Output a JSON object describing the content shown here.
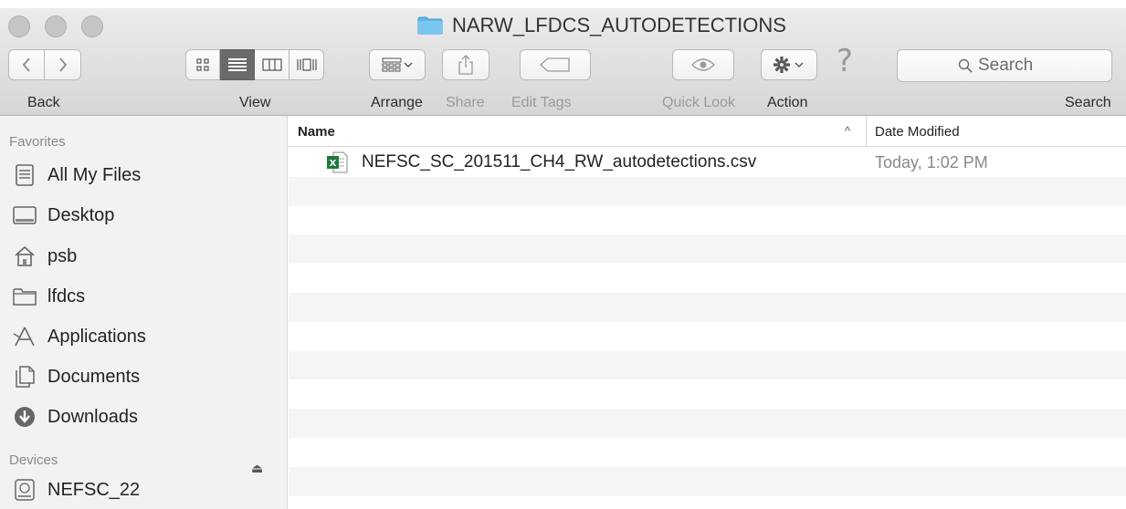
{
  "window": {
    "title": "NARW_LFDCS_AUTODETECTIONS"
  },
  "toolbar": {
    "back_label": "Back",
    "view_label": "View",
    "arrange_label": "Arrange",
    "share_label": "Share",
    "edit_tags_label": "Edit Tags",
    "quick_look_label": "Quick Look",
    "action_label": "Action",
    "search_label": "Search",
    "search_placeholder": "Search"
  },
  "sidebar": {
    "favorites_heading": "Favorites",
    "favorites": [
      {
        "label": "All My Files",
        "icon": "all-files-icon"
      },
      {
        "label": "Desktop",
        "icon": "desktop-icon"
      },
      {
        "label": "psb",
        "icon": "home-icon"
      },
      {
        "label": "lfdcs",
        "icon": "folder-icon"
      },
      {
        "label": "Applications",
        "icon": "applications-icon"
      },
      {
        "label": "Documents",
        "icon": "documents-icon"
      },
      {
        "label": "Downloads",
        "icon": "downloads-icon"
      }
    ],
    "devices_heading": "Devices",
    "devices": [
      {
        "label": "NEFSC_22",
        "icon": "disk-icon"
      }
    ]
  },
  "list": {
    "columns": {
      "name": "Name",
      "date_modified": "Date Modified"
    },
    "files": [
      {
        "name": "NEFSC_SC_201511_CH4_RW_autodetections.csv",
        "date": "Today, 1:02 PM",
        "icon": "excel-csv-icon"
      }
    ]
  },
  "colors": {
    "folder_accent": "#5fb6ea",
    "excel_green": "#1f7a3a",
    "selected_view_segment": "#6a6a6a"
  }
}
